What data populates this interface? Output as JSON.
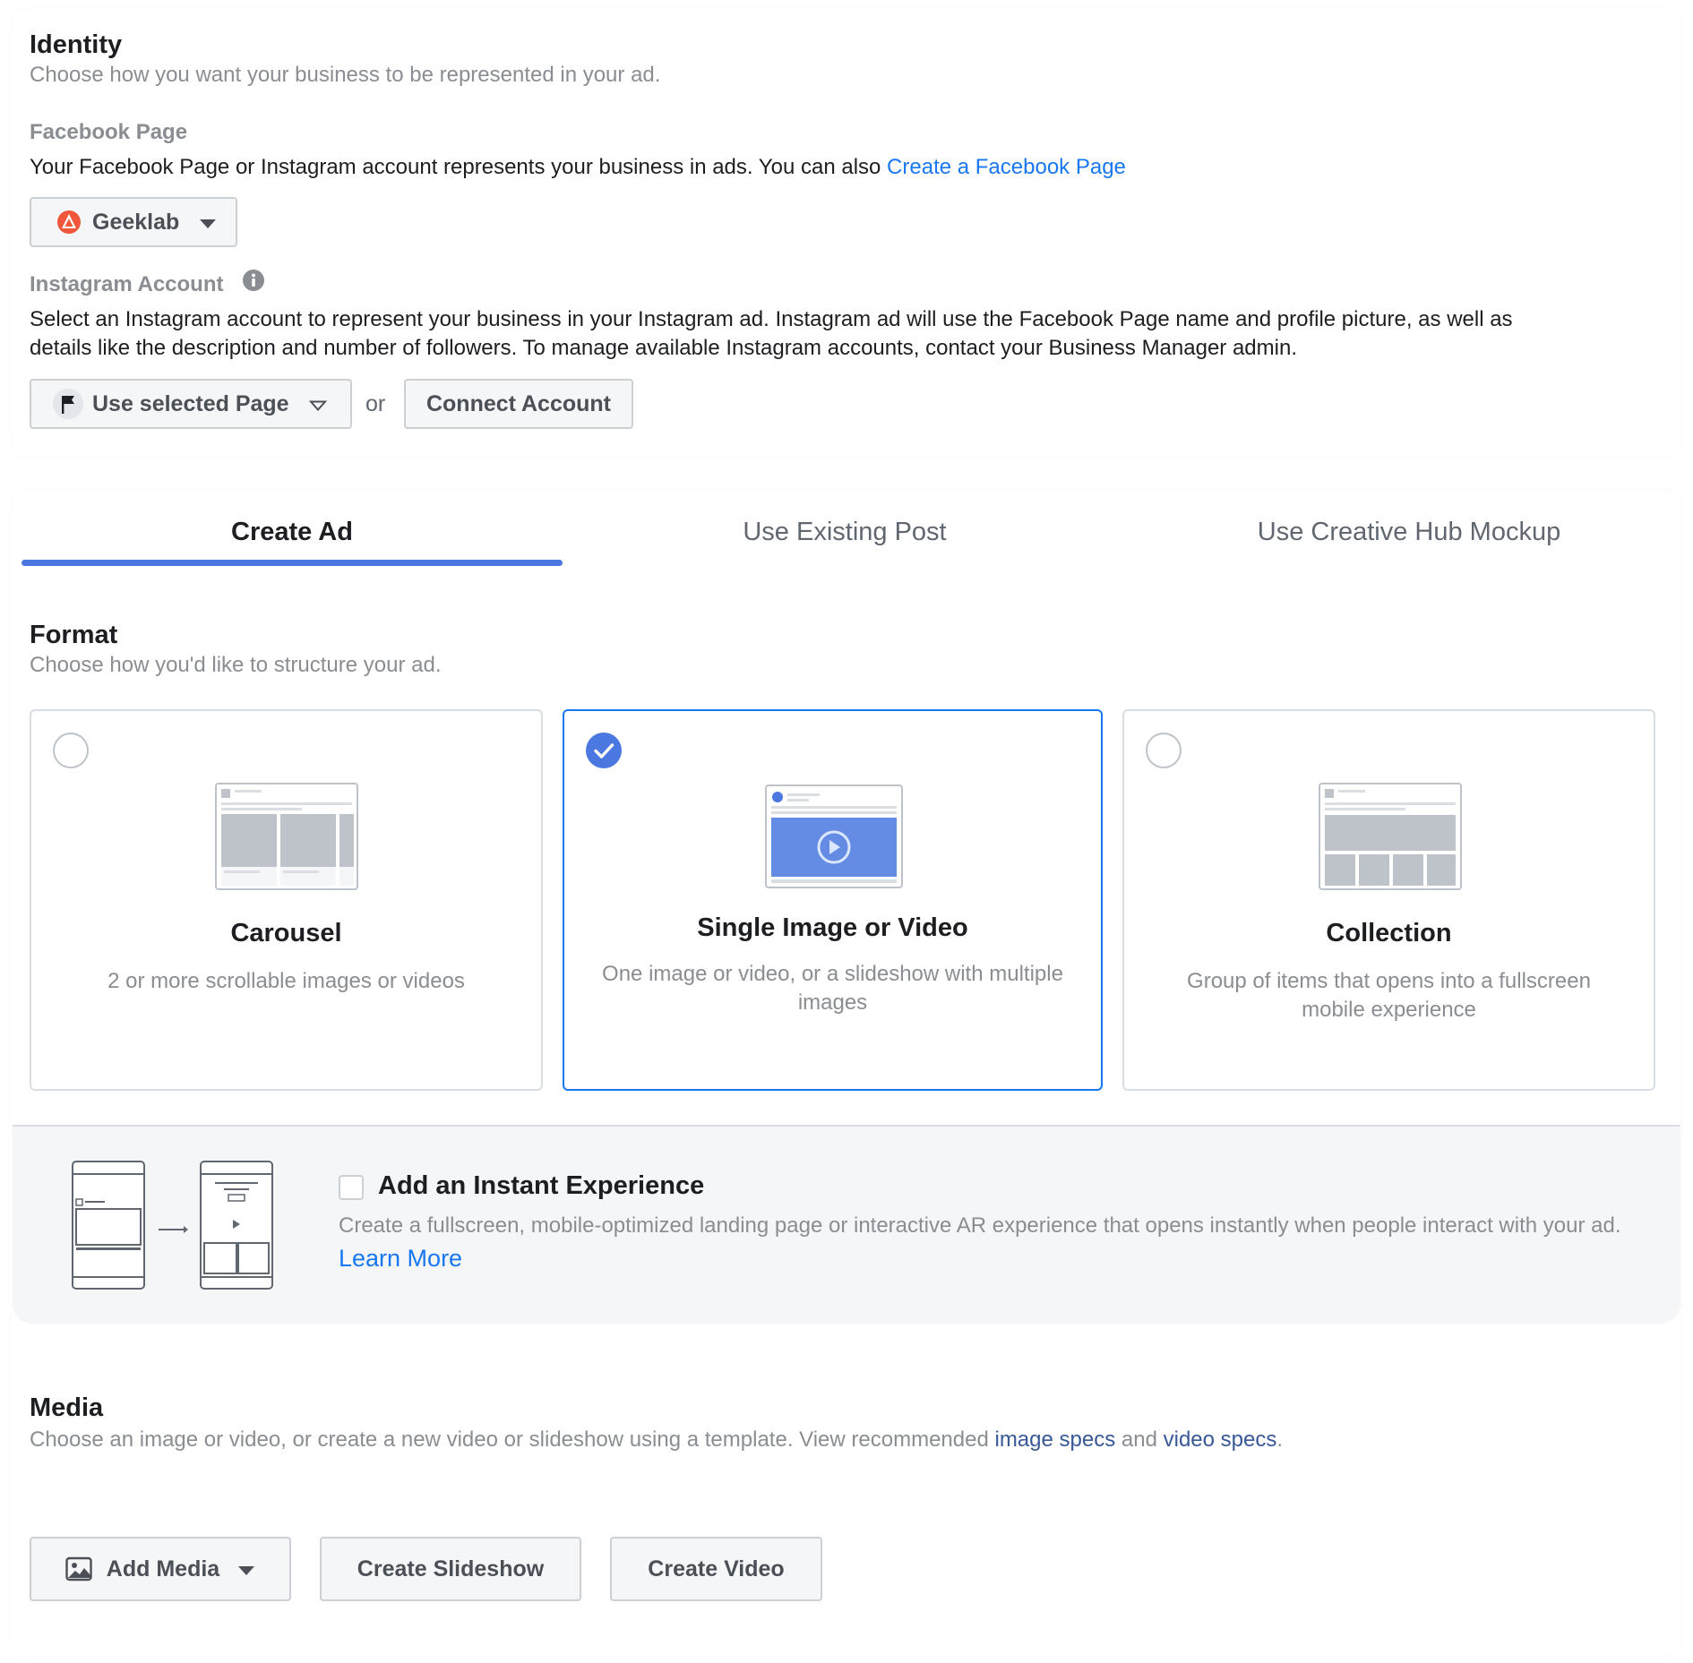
{
  "identity": {
    "title": "Identity",
    "subtitle": "Choose how you want your business to be represented in your ad.",
    "facebook_page": {
      "label": "Facebook Page",
      "description": "Your Facebook Page or Instagram account represents your business in ads. You can also",
      "create_link": "Create a Facebook Page",
      "selected_page": "Geeklab"
    },
    "instagram": {
      "label": "Instagram Account",
      "description_line1": "Select an Instagram account to represent your business in your Instagram ad. Instagram ad will use the Facebook Page name and profile picture, as well as",
      "description_line2": "details like the description and number of followers. To manage available Instagram accounts, contact your Business Manager admin.",
      "select_value": "Use selected Page",
      "or_text": "or",
      "connect_button": "Connect Account"
    }
  },
  "tabs": [
    {
      "label": "Create Ad",
      "active": true
    },
    {
      "label": "Use Existing Post",
      "active": false
    },
    {
      "label": "Use Creative Hub Mockup",
      "active": false
    }
  ],
  "format": {
    "title": "Format",
    "subtitle": "Choose how you'd like to structure your ad.",
    "options": [
      {
        "title": "Carousel",
        "description": "2 or more scrollable images or videos",
        "selected": false
      },
      {
        "title": "Single Image or Video",
        "description": "One image or video, or a slideshow with multiple images",
        "selected": true
      },
      {
        "title": "Collection",
        "description": "Group of items that opens into a fullscreen mobile experience",
        "selected": false
      }
    ]
  },
  "instant_experience": {
    "title": "Add an Instant Experience",
    "description": "Create a fullscreen, mobile-optimized landing page or interactive AR experience that opens instantly when people interact with your ad.",
    "learn_more": "Learn More",
    "checked": false
  },
  "media": {
    "title": "Media",
    "subtitle_prefix": "Choose an image or video, or create a new video or slideshow using a template. View recommended",
    "image_specs": "image specs",
    "and_text": "and",
    "video_specs": "video specs",
    "period": ".",
    "buttons": {
      "add_media": "Add Media",
      "create_slideshow": "Create Slideshow",
      "create_video": "Create Video"
    }
  },
  "colors": {
    "accent": "#1877f2",
    "tab_underline": "#4a78e0",
    "link_dark": "#385898"
  }
}
